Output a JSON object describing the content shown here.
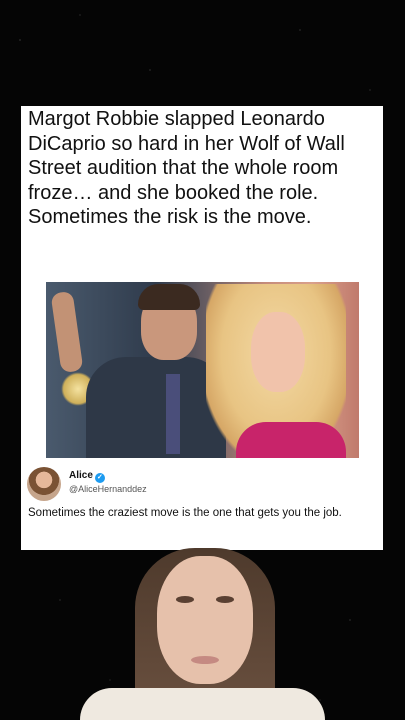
{
  "post": {
    "headline": "Margot Robbie slapped Leonardo DiCaprio so hard in her Wolf of Wall Street audition that the whole room froze… and she booked the role. Sometimes the risk is the move."
  },
  "tweet": {
    "name": "Alice",
    "handle": "@AliceHernanddez",
    "text": "Sometimes the craziest move is the one that gets you the job.",
    "verified_glyph": "✓"
  },
  "colors": {
    "verified": "#1d9bf0",
    "card": "#ffffff",
    "background": "#050505"
  }
}
